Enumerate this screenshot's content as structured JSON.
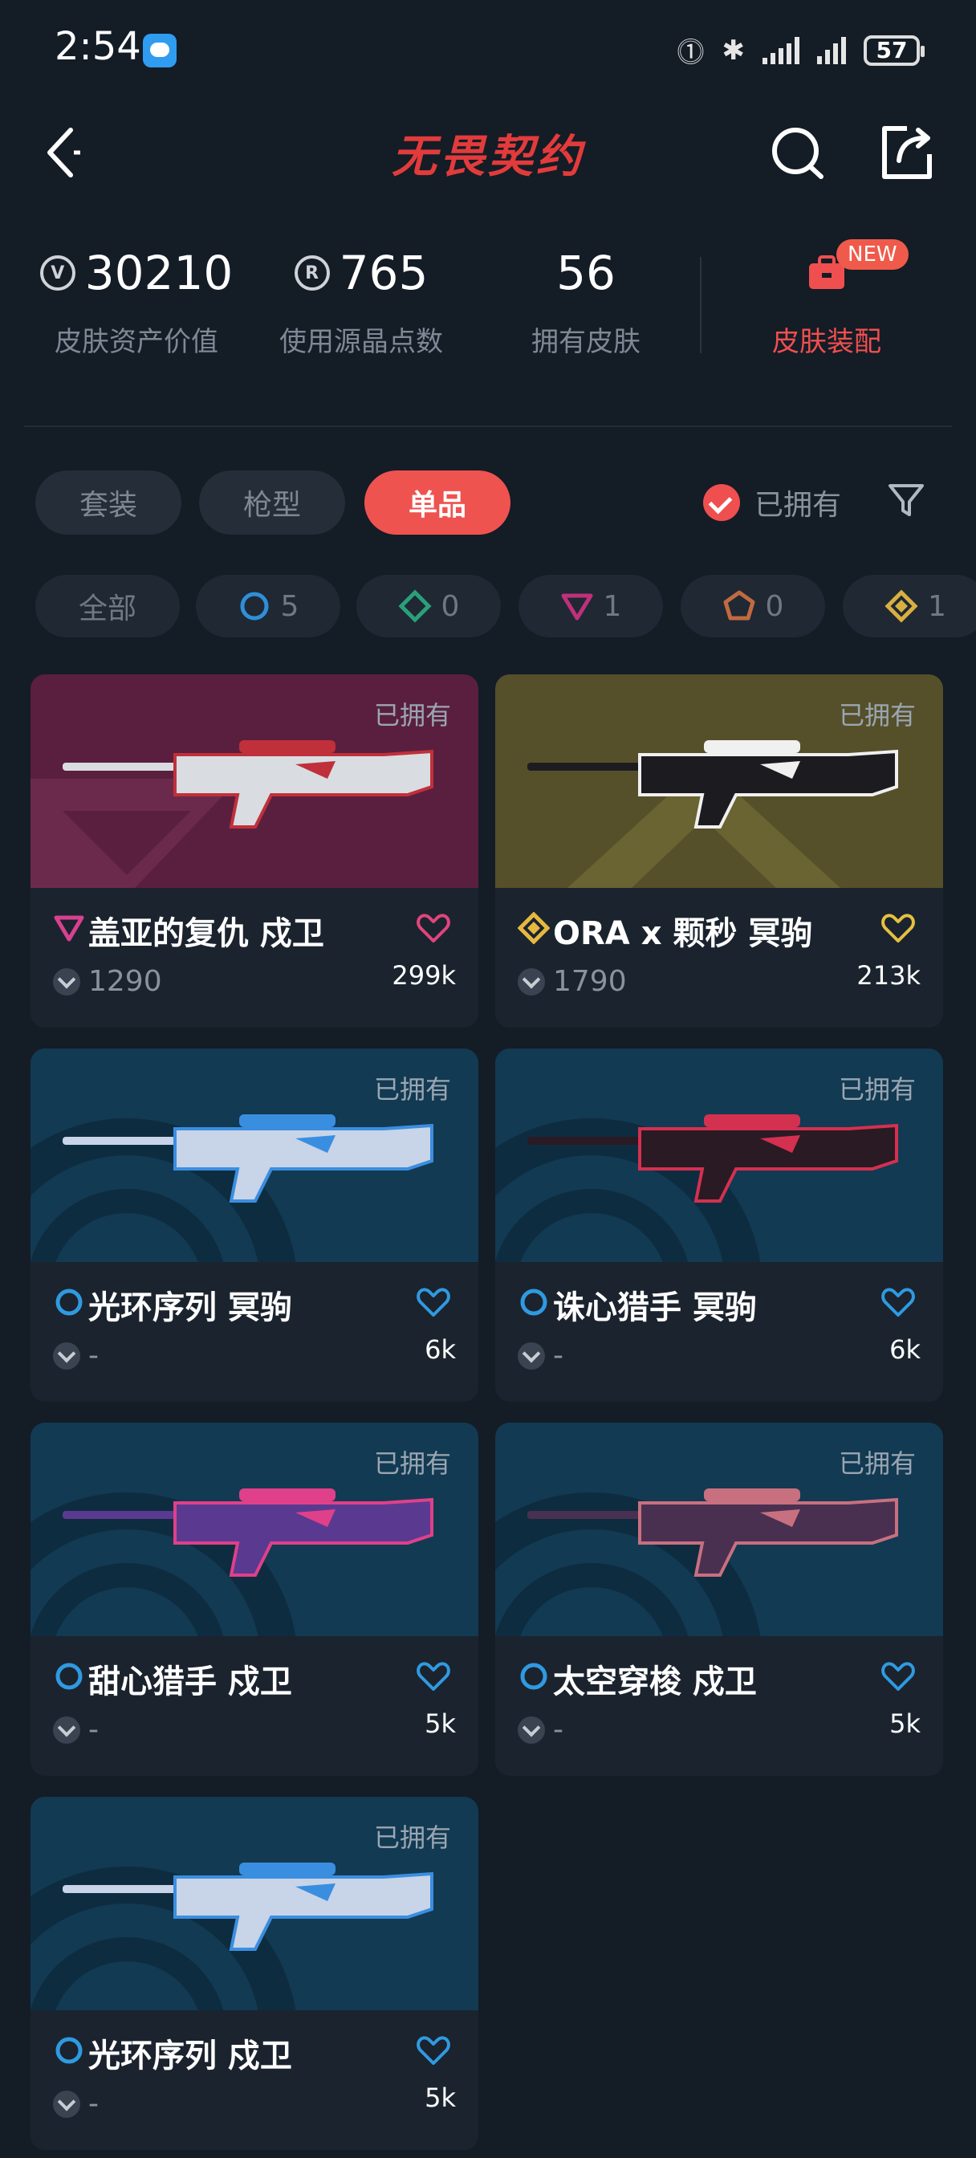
{
  "status": {
    "time": "2:54",
    "battery": "57"
  },
  "header": {
    "title": "无畏契约"
  },
  "stats": [
    {
      "value": "30210",
      "label": "皮肤资产价值"
    },
    {
      "value": "765",
      "label": "使用源晶点数"
    },
    {
      "value": "56",
      "label": "拥有皮肤"
    }
  ],
  "equip": {
    "label": "皮肤装配",
    "badge": "NEW"
  },
  "tabs": [
    "套装",
    "枪型",
    "单品"
  ],
  "owned_filter": "已拥有",
  "tiers": [
    {
      "label": "全部"
    },
    {
      "count": "5",
      "color": "#2f8fd8"
    },
    {
      "count": "0",
      "color": "#2aa07a"
    },
    {
      "count": "1",
      "color": "#c0307a"
    },
    {
      "count": "0",
      "color": "#c06a40"
    },
    {
      "count": "1",
      "color": "#d8b040"
    }
  ],
  "cards": [
    {
      "owned": "已拥有",
      "name": "盖亚的复仇 戍卫",
      "price": "1290",
      "likes": "299k",
      "tier_color": "#d94090",
      "heart_color": "#e0457d",
      "bg": "magenta"
    },
    {
      "owned": "已拥有",
      "name": "ORA x 颗秒 冥驹",
      "price": "1790",
      "likes": "213k",
      "tier_color": "#e6b840",
      "heart_color": "#e6c040",
      "bg": "gold"
    },
    {
      "owned": "已拥有",
      "name": "光环序列 冥驹",
      "price": "-",
      "likes": "6k",
      "tier_color": "#2f9ae0",
      "heart_color": "#2f9ae0",
      "bg": "blue"
    },
    {
      "owned": "已拥有",
      "name": "诛心猎手 冥驹",
      "price": "-",
      "likes": "6k",
      "tier_color": "#2f9ae0",
      "heart_color": "#2f9ae0",
      "bg": "blue"
    },
    {
      "owned": "已拥有",
      "name": "甜心猎手 戍卫",
      "price": "-",
      "likes": "5k",
      "tier_color": "#2f9ae0",
      "heart_color": "#2f9ae0",
      "bg": "blue"
    },
    {
      "owned": "已拥有",
      "name": "太空穿梭 戍卫",
      "price": "-",
      "likes": "5k",
      "tier_color": "#2f9ae0",
      "heart_color": "#2f9ae0",
      "bg": "blue"
    },
    {
      "owned": "已拥有",
      "name": "光环序列 戍卫",
      "price": "-",
      "likes": "5k",
      "tier_color": "#2f9ae0",
      "heart_color": "#2f9ae0",
      "bg": "blue"
    }
  ]
}
